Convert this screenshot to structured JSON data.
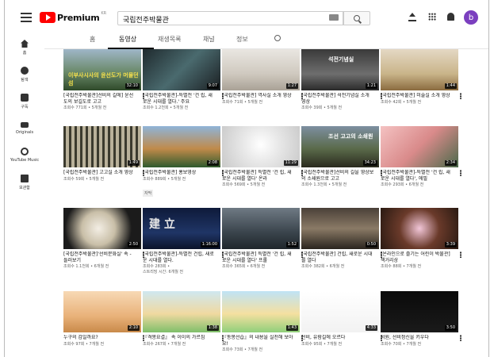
{
  "header": {
    "logo_text": "Premium",
    "logo_sup": "KR",
    "search_value": "국립전주박물관",
    "avatar_letter": "b"
  },
  "sidebar": {
    "items": [
      {
        "label": "홈",
        "icon": "home-icon"
      },
      {
        "label": "탐색",
        "icon": "explore-icon"
      },
      {
        "label": "구독",
        "icon": "subscriptions-icon"
      },
      {
        "label": "Originals",
        "icon": "originals-icon"
      },
      {
        "label": "YouTube Music",
        "icon": "music-icon"
      },
      {
        "label": "보관함",
        "icon": "library-icon"
      }
    ]
  },
  "tabs": [
    "홈",
    "동영상",
    "재생목록",
    "채널",
    "정보"
  ],
  "videos": [
    {
      "title": "[국립전주박물관]선비의 길에] 윤선도의 보길도로 고고",
      "meta": "조회수 771회 • 5개월 전",
      "duration": "32:10",
      "overlay": "이부사시사의 윤선도가 머물던 섬",
      "bg": "linear-gradient(180deg,#9fb6c8 0%,#6b8a6a 55%,#2f4a2a 100%)"
    },
    {
      "title": "[국립전주박물관]-특별전 '건 립, 새로운 시대를 열다.' 주요",
      "meta": "조회수 1.2천회 • 5개월 전",
      "duration": "9:07",
      "bg": "linear-gradient(135deg,#1f2a2e 0%,#4a6a6e 50%,#1b1f22 100%)"
    },
    {
      "title": "[국립전주박물관] 역사실 소개 영상",
      "meta": "조회수 71회 • 5개월 전",
      "duration": "1:27",
      "bg": "linear-gradient(180deg,#e9e6e1 0%,#cfc9bf 60%,#a9a196 100%)"
    },
    {
      "title": "[국립전주박물관] 석전기념실 소개 영상",
      "meta": "조회수 39회 • 5개월 전",
      "duration": "1:21",
      "overlay": "석전기념실",
      "bg": "linear-gradient(180deg,#3a3a3a 0%,#6e6e6e 60%,#2a2a2a 100%)"
    },
    {
      "title": "[국립전주박물관] 미술실 소개 영상",
      "meta": "조회수 42회 • 5개월 전",
      "duration": "1:44",
      "bg": "linear-gradient(180deg,#e4d8c4 0%,#c9b489 60%,#8a6b3f 100%)"
    },
    {
      "title": "[국립전주박물관] 고고실 소개 영상",
      "meta": "조회수 59회 • 5개월 전",
      "duration": "1:49",
      "bg": "repeating-linear-gradient(90deg,#3b3a2e 0px,#3b3a2e 3px,#b9b19a 3px,#b9b19a 7px)"
    },
    {
      "title": "[국립전주박물관] 홍보영상",
      "meta": "조회수 889회 • 5개월 전",
      "badge": "자막",
      "duration": "2:08",
      "bg": "linear-gradient(180deg,#8fb4d9 0%,#c08a4a 55%,#2f5a2e 100%)"
    },
    {
      "title": "[국립전주박물관] 특별전 '건 립, 새로운 시대를 열다' 온라",
      "meta": "조회수 569회 • 5개월 전",
      "duration": "11:29",
      "bg": "radial-gradient(circle at 50% 45%,#ffffff 0%,#e8e8e8 40%,#c9c9c9 100%)"
    },
    {
      "title": "[국립전주박물관]선비의 길을 영상보의 소쇄원으로 고고",
      "meta": "조회수 1.3천회 • 5개월 전",
      "duration": "34:23",
      "overlay": "조선 고고의 소쇄원",
      "bg": "linear-gradient(180deg,#7d8fa0 0%,#5a6a4a 55%,#2a2a1e 100%)"
    },
    {
      "title": "[국립전주박물관]-특별전 '건 립, 새로운 시대를 열다', 에필",
      "meta": "조회수 293회 • 6개월 전",
      "duration": "2:34",
      "bg": "linear-gradient(135deg,#f4c2c2 0%,#d98a8a 50%,#4a6a4a 100%)"
    },
    {
      "title": "[국립전주박물관]'선비문화실' 속 - 들러보기",
      "meta": "조회수 1.1천회 • 6개월 전",
      "duration": "2:50",
      "bg": "radial-gradient(circle at 45% 50%,#f3eee4 0%,#c9bfa8 35%,#1b1b1b 70%)"
    },
    {
      "title": "[국립전주박물관]-특별전 건립, 새로운 시대를 열다.",
      "meta": "조회수 283회 •",
      "meta2": "스트리밍 시간: 6개월 전",
      "duration": "1:16:00",
      "overlay": "建 立",
      "bg": "linear-gradient(180deg,#0e1a3a 0%,#1f3566 60%,#0b132a 100%)"
    },
    {
      "title": "[국립전주박물관] 특별전 '건 립, 새로운 시대를 열다' 프롤",
      "meta": "조회수 365회 • 6개월 전",
      "duration": "1:52",
      "bg": "linear-gradient(180deg,#6f7a84 0%,#3a444c 60%,#1f262b 100%)"
    },
    {
      "title": "[국립전주박물관] 건립, 새로운 시대를 열다",
      "meta": "조회수 382회 • 6개월 전",
      "duration": "0:50",
      "bg": "linear-gradient(180deg,#4a4038 0%,#8a7a66 50%,#2a241e 100%)"
    },
    {
      "title": "[온라인으로 즐기는 어린이 박물관] 책거리상",
      "meta": "조회수 88회 • 7개월 전",
      "duration": "3:39",
      "bg": "radial-gradient(circle at 50% 50%,#f2c6d8 0%,#6a3a2a 45%,#2a1a12 100%)"
    },
    {
      "title": "누구의 감일까요?",
      "meta": "조회수 97회 • 7개월 전",
      "duration": "2:10",
      "bg": "linear-gradient(180deg,#f7d9b5 0%,#e9b27a 60%,#c98a4a 100%)"
    },
    {
      "title": "『격몽요결』 속 이이의 가르침",
      "meta": "조회수 267회 • 7개월 전",
      "duration": "1:38",
      "bg": "linear-gradient(180deg,#cfe8f0 0%,#f0d9a0 55%,#7fbf6a 100%)"
    },
    {
      "title": "『동몽선습』의 내용을 실천해 보아요!",
      "meta": "조회수 73회 • 7개월 전",
      "duration": "1:43",
      "bg": "linear-gradient(180deg,#bfe3f5 0%,#f5e0a0 55%,#8fcf7a 100%)"
    },
    {
      "title": "선비, 유람길에 오르다",
      "meta": "조회수 95회 • 7개월 전",
      "duration": "4:33",
      "bg": "linear-gradient(180deg,#ffffff 0%,#f2f2f2 100%)"
    },
    {
      "title": "서원, 선비정신을 키우다",
      "meta": "조회수 70회 • 7개월 전",
      "duration": "3:50",
      "bg": "linear-gradient(180deg,#0a0a0a 0%,#1a1a1a 100%)"
    }
  ]
}
